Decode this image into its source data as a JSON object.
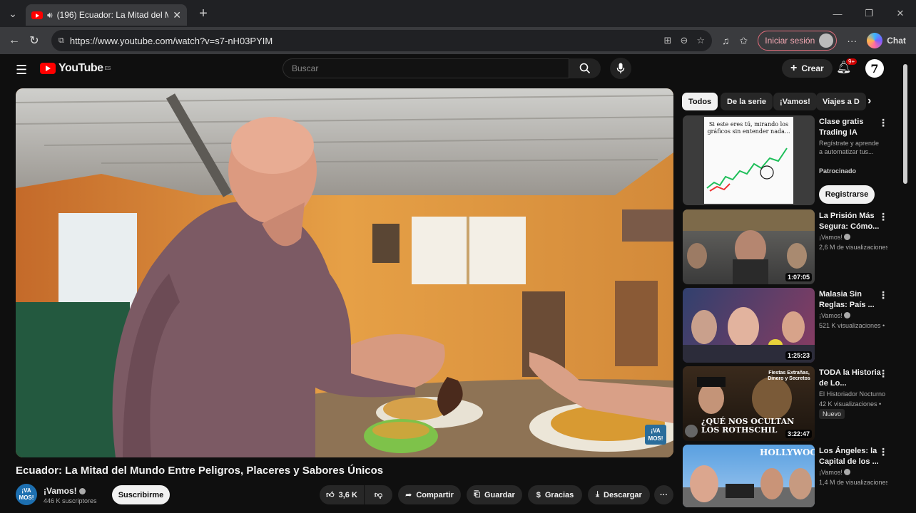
{
  "browser": {
    "tab_title": "(196) Ecuador: La Mitad del M",
    "url": "https://www.youtube.com/watch?v=s7-nH03PYIM",
    "signin_label": "Iniciar sesión",
    "chat_label": "Chat"
  },
  "youtube": {
    "logo_text": "YouTube",
    "region": "ES",
    "search_placeholder": "Buscar",
    "create_label": "Crear",
    "notif_count": "9+",
    "profile_letter": "7"
  },
  "video": {
    "title": "Ecuador: La Mitad del Mundo Entre Peligros, Placeres y Sabores Únicos",
    "watermark": "¡VA MOS!",
    "channel": {
      "avatar_text": "¡VA MOS!",
      "name": "¡Vamos!",
      "subscribers": "446 K suscriptores",
      "subscribe_label": "Suscribirme"
    },
    "actions": {
      "likes": "3,6 K",
      "share": "Compartir",
      "save": "Guardar",
      "thanks": "Gracias",
      "download": "Descargar"
    }
  },
  "chips": [
    "Todos",
    "De la serie",
    "¡Vamos!",
    "Viajes a D"
  ],
  "ad": {
    "thumb_text": "Si este eres tú, mirando los gráficos sin entender nada...",
    "title": "Clase gratis Trading IA",
    "desc": "Regístrate y aprende a automatizar tus...",
    "sponsored": "Patrocinado",
    "cta": "Registrarse"
  },
  "recommendations": [
    {
      "title": "La Prisión Más Segura: Cómo...",
      "channel": "¡Vamos!",
      "views": "2,6 M de visualizaciones",
      "duration": "1:07:05"
    },
    {
      "title": "Malasia Sin Reglas: País ...",
      "channel": "¡Vamos!",
      "views": "521 K visualizaciones •",
      "duration": "1:25:23"
    },
    {
      "title": "TODA la Historia de Lo...",
      "channel": "El Historiador Nocturno",
      "views": "42 K visualizaciones •",
      "badge": "Nuevo",
      "duration": "3:22:47",
      "thumb_text": "¿QUÉ NOS OCULTAN LOS ROTHSCHIL",
      "thumb_subtext": "Fiestas Extrañas, Dinero y Secretos"
    },
    {
      "title": "Los Ángeles: la Capital de los ...",
      "channel": "¡Vamos!",
      "views": "1,4 M de visualizaciones",
      "thumb_text": "HOLLYWOOD"
    }
  ],
  "colors": {
    "accent_red": "#ff0000",
    "background": "#0f0f0f",
    "chip_bg": "#272727"
  }
}
